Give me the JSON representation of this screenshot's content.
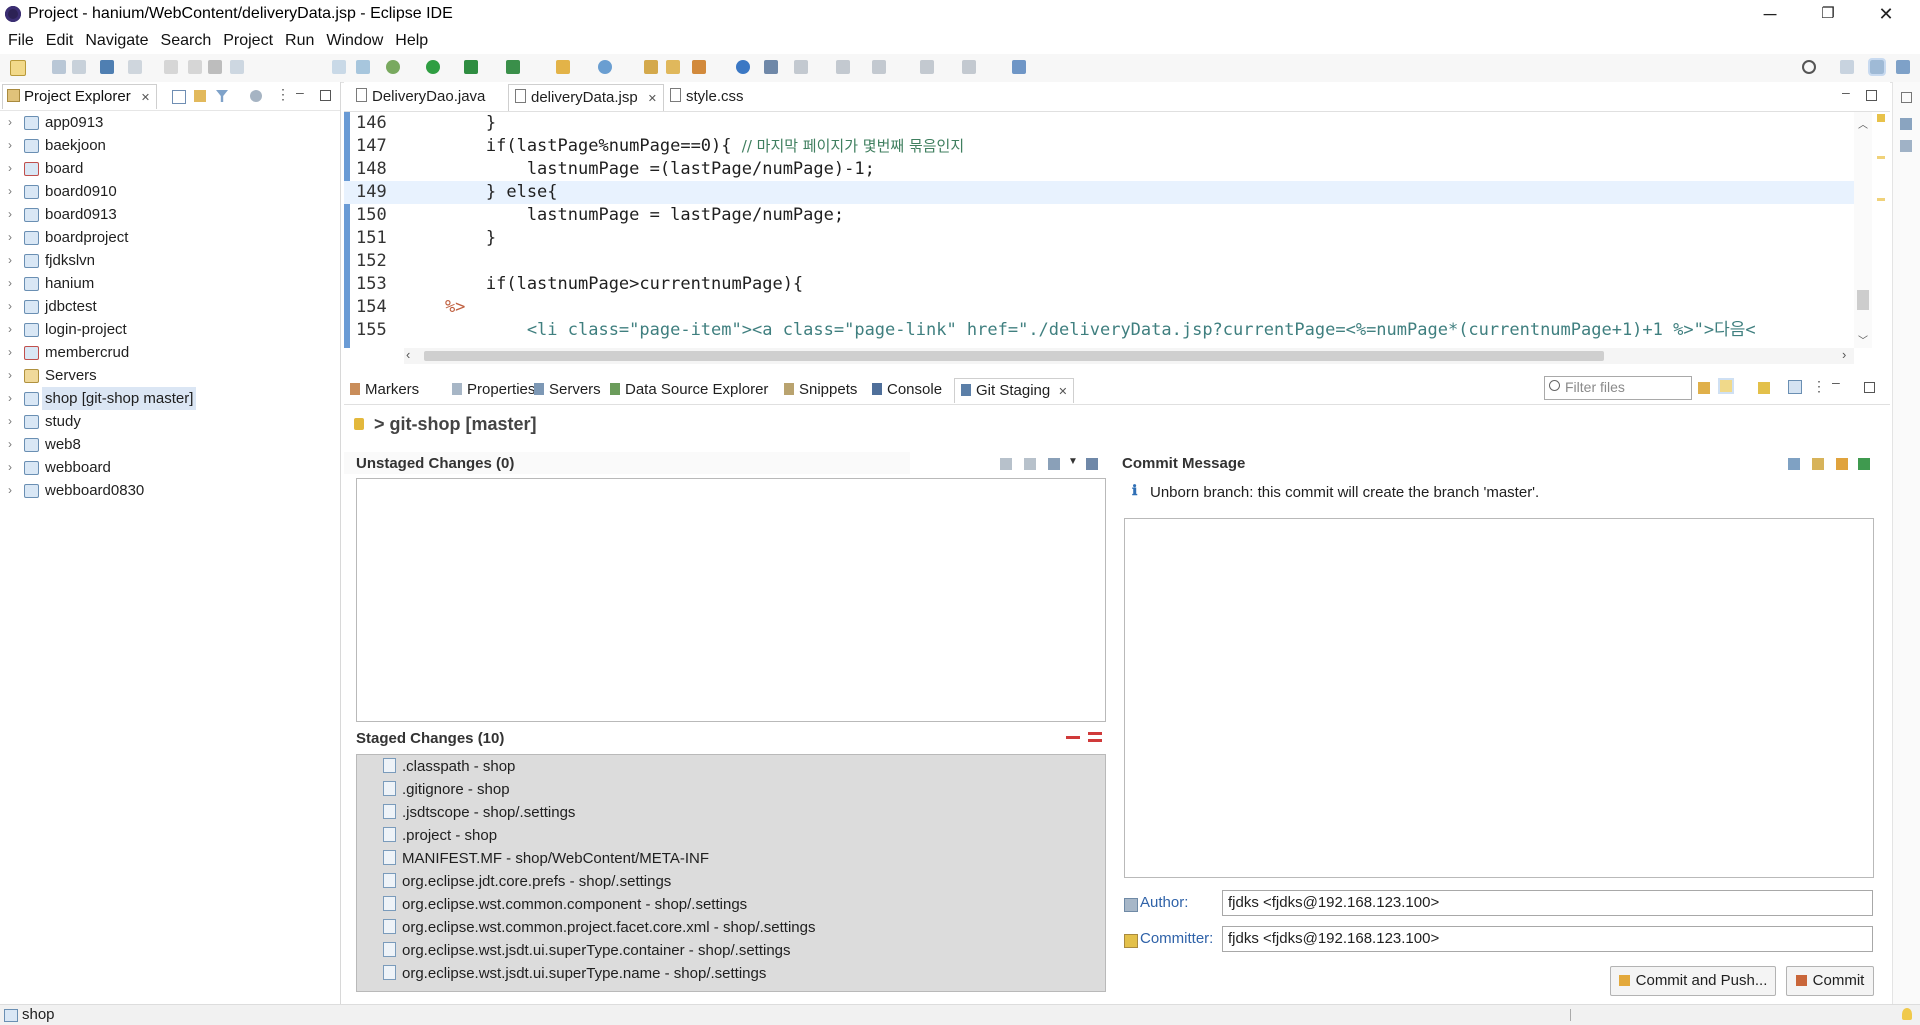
{
  "window": {
    "title": "Project - hanium/WebContent/deliveryData.jsp - Eclipse IDE",
    "minimize": "─",
    "restore": "❐",
    "close": "✕"
  },
  "menu": [
    "File",
    "Edit",
    "Navigate",
    "Search",
    "Project",
    "Run",
    "Window",
    "Help"
  ],
  "project_explorer": {
    "tab_label": "Project Explorer",
    "close_glyph": "✕",
    "items": [
      {
        "label": "app0913"
      },
      {
        "label": "baekjoon"
      },
      {
        "label": "board"
      },
      {
        "label": "board0910"
      },
      {
        "label": "board0913"
      },
      {
        "label": "boardproject"
      },
      {
        "label": "fjdkslvn"
      },
      {
        "label": "hanium"
      },
      {
        "label": "jdbctest"
      },
      {
        "label": "login-project"
      },
      {
        "label": "membercrud"
      },
      {
        "label": "Servers"
      },
      {
        "label": "shop [git-shop master]",
        "selected": true
      },
      {
        "label": "study"
      },
      {
        "label": "web8"
      },
      {
        "label": "webboard"
      },
      {
        "label": "webboard0830"
      }
    ]
  },
  "editor": {
    "tabs": [
      {
        "label": "DeliveryDao.java"
      },
      {
        "label": "deliveryData.jsp",
        "active": true
      },
      {
        "label": "style.css"
      }
    ],
    "lines": [
      {
        "num": "146",
        "text": "        }"
      },
      {
        "num": "147",
        "text": "        if(lastPage%numPage==0){ ",
        "comment": "// 마지막 페이지가 몇번째 묶음인지"
      },
      {
        "num": "148",
        "text": "            lastnumPage =(lastPage/numPage)-1;"
      },
      {
        "num": "149",
        "text": "        } else{"
      },
      {
        "num": "150",
        "text": "            lastnumPage = lastPage/numPage;"
      },
      {
        "num": "151",
        "text": "        }"
      },
      {
        "num": "152",
        "text": ""
      },
      {
        "num": "153",
        "text": "        if(lastnumPage>currentnumPage){"
      },
      {
        "num": "154",
        "text": "    %>"
      },
      {
        "num": "155",
        "text": "            <li class=\"page-item\"><a class=\"page-link\" href=\"./deliveryData.jsp?currentPage=<%=numPage*(currentnumPage+1)+1 %>\">다음<"
      }
    ]
  },
  "bottom_tabs": [
    {
      "label": "Markers"
    },
    {
      "label": "Properties"
    },
    {
      "label": "Servers"
    },
    {
      "label": "Data Source Explorer"
    },
    {
      "label": "Snippets"
    },
    {
      "label": "Console"
    },
    {
      "label": "Git Staging",
      "active": true
    }
  ],
  "git_staging": {
    "filter_placeholder": "Filter files",
    "repo_title": "> git-shop [master]",
    "unstaged_title": "Unstaged Changes (0)",
    "staged_title": "Staged Changes (10)",
    "staged_files": [
      ".classpath - shop",
      ".gitignore - shop",
      ".jsdtscope - shop/.settings",
      ".project - shop",
      "MANIFEST.MF - shop/WebContent/META-INF",
      "org.eclipse.jdt.core.prefs - shop/.settings",
      "org.eclipse.wst.common.component - shop/.settings",
      "org.eclipse.wst.common.project.facet.core.xml - shop/.settings",
      "org.eclipse.wst.jsdt.ui.superType.container - shop/.settings",
      "org.eclipse.wst.jsdt.ui.superType.name - shop/.settings"
    ],
    "commit_message_title": "Commit Message",
    "info_text": "Unborn branch: this commit will create the branch 'master'.",
    "author_label": "Author:",
    "author_value": "fjdks <fjdks@192.168.123.100>",
    "committer_label": "Committer:",
    "committer_value": "fjdks <fjdks@192.168.123.100>",
    "commit_and_push_label": "Commit and Push...",
    "commit_label": "Commit"
  },
  "status": {
    "text": "shop"
  },
  "colors": {
    "selection": "#dbe6f4",
    "keyword": "#7f0055",
    "comment": "#3f7f5f",
    "string": "#2a00ff",
    "highlight_line": "#e8f2fe"
  }
}
